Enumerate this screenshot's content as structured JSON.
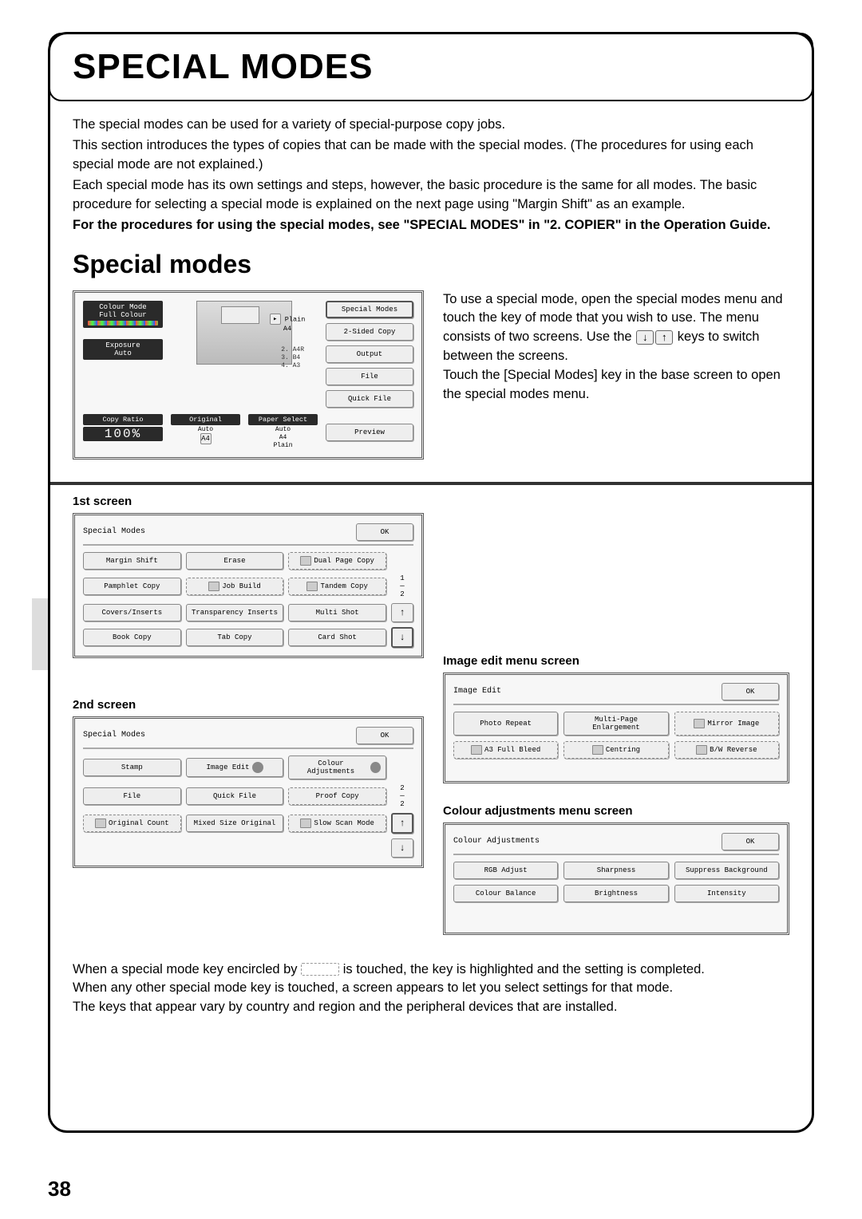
{
  "page": {
    "heading": "SPECIAL MODES",
    "section_title": "Special modes",
    "page_number": "38"
  },
  "intro": {
    "p1": "The special modes can be used for a variety of special-purpose copy jobs.",
    "p2": "This section introduces the types of copies that can be made with the special modes. (The procedures for using each special mode are not explained.)",
    "p3": "Each special mode has its own settings and steps, however, the basic procedure is the same for all modes. The basic procedure for selecting a special mode is explained on the next page using \"Margin Shift\" as an example.",
    "p4": "For the procedures for using the special modes, see \"SPECIAL MODES\" in \"2. COPIER\" in the Operation Guide."
  },
  "base_screen": {
    "colour_mode": "Colour Mode",
    "full_colour": "Full Colour",
    "exposure": "Exposure",
    "auto": "Auto",
    "copy_ratio": "Copy Ratio",
    "ratio_pct": "100%",
    "original": "Original",
    "original_sub": "Auto",
    "paper_select": "Paper Select",
    "paper_sub1": "Auto",
    "paper_sub2": "A4",
    "paper_sub3": "Plain",
    "tray_plain": "Plain",
    "tray_a4": "A4",
    "trays_l2": "2.  A4R",
    "trays_l3": "3.  B4",
    "trays_l4": "4.  A3",
    "special_modes": "Special Modes",
    "two_sided": "2-Sided Copy",
    "output": "Output",
    "file": "File",
    "quick_file": "Quick File",
    "preview": "Preview"
  },
  "instr": {
    "p1": "To use a special mode, open the special modes menu and touch the key of mode that you wish to use. The menu consists of two screens. Use the ",
    "p1b": " keys to switch between the screens.",
    "p2": "Touch the [Special Modes] key in the base screen to open the special modes menu."
  },
  "screens": {
    "first_label": "1st screen",
    "second_label": "2nd screen",
    "title": "Special Modes",
    "ok": "OK"
  },
  "first_screen": {
    "margin_shift": "Margin Shift",
    "erase": "Erase",
    "dual_page": "Dual Page Copy",
    "pamphlet": "Pamphlet Copy",
    "job_build": "Job Build",
    "tandem": "Tandem Copy",
    "covers_inserts": "Covers/Inserts",
    "transparency": "Transparency Inserts",
    "multi_shot": "Multi Shot",
    "book_copy": "Book Copy",
    "tab_copy": "Tab Copy",
    "card_shot": "Card Shot",
    "page_ind": "1",
    "page_tot": "2"
  },
  "second_screen": {
    "stamp": "Stamp",
    "image_edit": "Image Edit",
    "colour_adj": "Colour Adjustments",
    "file": "File",
    "quick_file": "Quick File",
    "proof_copy": "Proof Copy",
    "orig_count": "Original Count",
    "mixed_size": "Mixed Size Original",
    "slow_scan": "Slow Scan Mode",
    "page_ind": "2",
    "page_tot": "2"
  },
  "image_edit": {
    "label": "Image edit menu screen",
    "title": "Image Edit",
    "ok": "OK",
    "photo_repeat": "Photo Repeat",
    "multi_page": "Multi-Page Enlargement",
    "mirror": "Mirror Image",
    "a3_full": "A3 Full Bleed",
    "centring": "Centring",
    "bw_reverse": "B/W Reverse"
  },
  "colour_adj": {
    "label": "Colour adjustments menu screen",
    "title": "Colour Adjustments",
    "ok": "OK",
    "rgb": "RGB Adjust",
    "sharpness": "Sharpness",
    "suppress": "Suppress Background",
    "balance": "Colour Balance",
    "brightness": "Brightness",
    "intensity": "Intensity"
  },
  "note": {
    "t1": "When a special mode key encircled by ",
    "t2": " is touched, the key is highlighted and the setting is completed.",
    "t3": "When any other special mode key is touched, a screen appears to let you select settings for that mode.",
    "t4": "The keys that appear vary by country and region and the peripheral devices that are installed."
  }
}
